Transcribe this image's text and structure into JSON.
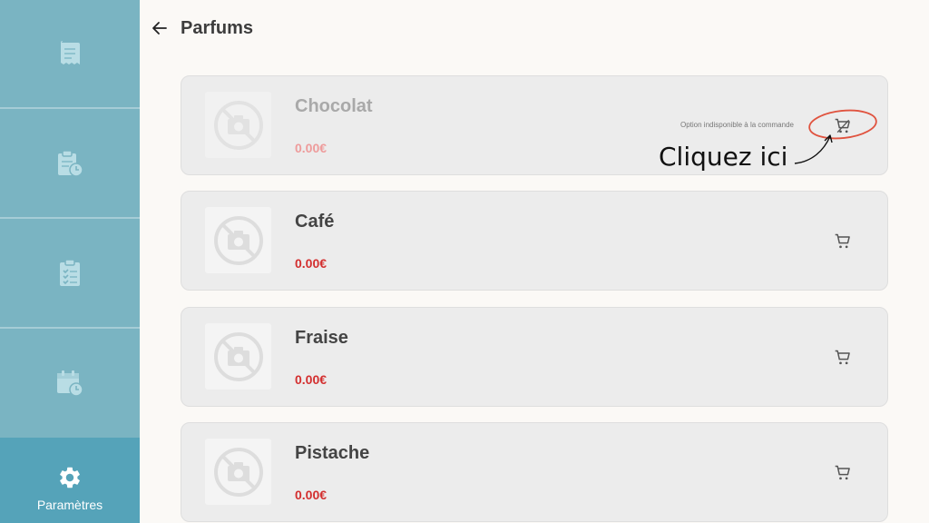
{
  "sidebar": {
    "items": [
      {
        "icon": "receipt-icon"
      },
      {
        "icon": "clipboard-clock-icon"
      },
      {
        "icon": "checklist-icon"
      },
      {
        "icon": "calendar-clock-icon"
      },
      {
        "icon": "gear-icon",
        "label": "Paramètres",
        "active": true
      }
    ]
  },
  "header": {
    "back_icon": "arrow-left-icon",
    "title": "Parfums"
  },
  "products": [
    {
      "name": "Chocolat",
      "price": "0.00€",
      "available": false,
      "unavailable_text": "Option indisponible à la commande"
    },
    {
      "name": "Café",
      "price": "0.00€",
      "available": true
    },
    {
      "name": "Fraise",
      "price": "0.00€",
      "available": true
    },
    {
      "name": "Pistache",
      "price": "0.00€",
      "available": true
    }
  ],
  "annotation": {
    "text": "Cliquez ici",
    "color": "#e0533f"
  },
  "colors": {
    "sidebar": "#7ab4c2",
    "sidebar_active": "#55a3b9",
    "price": "#d32f2f"
  }
}
